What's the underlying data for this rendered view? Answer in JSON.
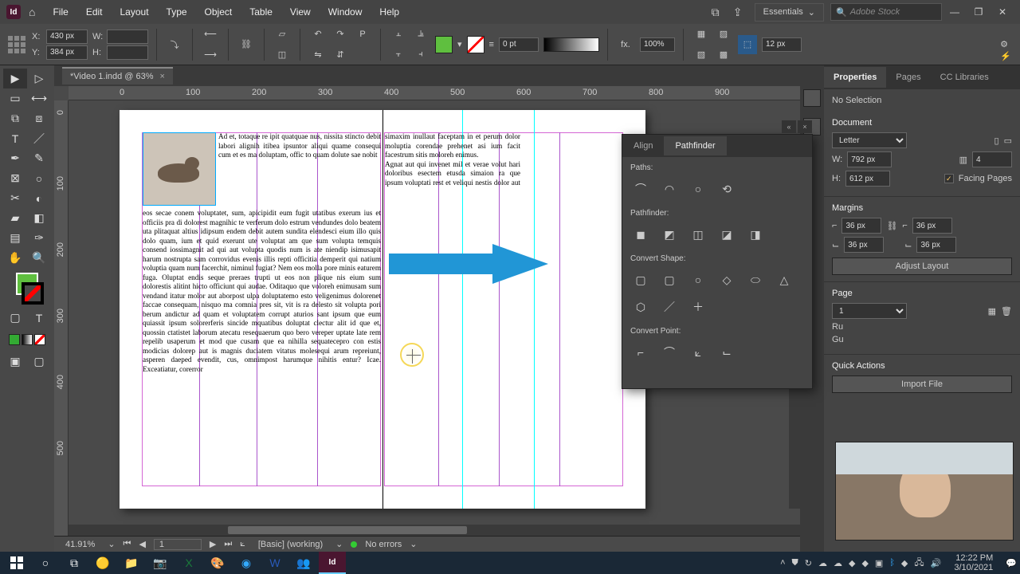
{
  "app": {
    "logo": "Id",
    "home": "⌂"
  },
  "menu": [
    "File",
    "Edit",
    "Layout",
    "Type",
    "Object",
    "Table",
    "View",
    "Window",
    "Help"
  ],
  "workspace": "Essentials",
  "search_placeholder": "Adobe Stock",
  "win_min": "—",
  "win_max": "❐",
  "win_close": "✕",
  "opt": {
    "x": "430 px",
    "y": "384 px",
    "w": "",
    "h": "",
    "stroke_wt": "0 pt",
    "opacity": "100%",
    "corner": "12 px"
  },
  "tab": {
    "name": "*Video 1.indd @ 63%"
  },
  "rulerh": {
    "0": "0",
    "100": "100",
    "200": "200",
    "300": "300",
    "400": "400",
    "500": "500",
    "600": "600",
    "700": "700",
    "800": "800",
    "900": "900"
  },
  "rulerv": {
    "0": "0",
    "100": "100",
    "200": "200",
    "300": "300",
    "400": "400",
    "500": "500"
  },
  "body1": "Ad et, totaque re ipit quatquae nus, nissita stincto debit labori alignih itibea ipsuntor aliqui quame consequi cum et es ma doluptam, offic to quam dolute sae nobit",
  "body2": "eos secae conem voluptatet, sum, apicipidit eum fugit utatibus exerum ius et officiis pra di dolorest magnihic te verferum dolo estrum vendundes dolo beatem uta plitaquat altius idipsum endem debit autem sundita elendesci eium illo quis dolo quam, ium et quid exerunt ute voluptat am que sum volupta temquis consend iossimagnit ad qui aut volupta quodis num is ate niendip isimusapit harum nostrupta sam corrovidus evenis illis repti officitia demperit qui natium voluptia quam num facerchit, niminul fugiat? Nem eos molla pore minis eaturem fuga. Oluptat endis seque preraes trupti ut eos non plique nis eium sum dolorestis alitint hicto officiunt qui audae. Oditaquo que voloreh enimusam sum vendand itatur molor aut aborpost ulpa doluptatemo esto veligenimus dolorenet faccae consequam, nisquo ma comnia pres sit, vit is ra delesto sit volupta pori berum andictur ad quam et voluptatem corrupt aturios sant ipsum que eum quiassit ipsum solorerferis sincide mquatibus doluptat clectur alit id que et, quossin ctatistet laborum atecatu resequaerum quo bero vereper uptate late rem repelib usaperum et mod que cusam que ea nihilla sequatecepro con estis modicias dolorep aut is magnis duciatem vitatus molesequi arum repreiunt, asperen daeped evendit, cus, omnimpost harumque nihitis entur? Icae. Exceatiatur, corerror",
  "body3": "simaxim inullaut faceptam in et perum dolor moluptia corendae prehenet asi ium facit facestrum sitis moloreh enimus.\nAgnat aut qui invenet mil et verae volut hari doloribus esectem etusda simaion ra que ipsum voluptati rest et veliqui nestis dolor aut exerend",
  "status": {
    "zoom": "41.91%",
    "page": "1",
    "preset": "[Basic]  (working)",
    "errors": "No errors"
  },
  "pathfinder": {
    "tab_align": "Align",
    "tab_pf": "Pathfinder",
    "paths": "Paths:",
    "pflabel": "Pathfinder:",
    "shape": "Convert Shape:",
    "point": "Convert Point:"
  },
  "props": {
    "tab_props": "Properties",
    "tab_pages": "Pages",
    "tab_cc": "CC Libraries",
    "nosel": "No Selection",
    "doc": "Document",
    "preset": "Letter",
    "w_lbl": "W:",
    "w": "792 px",
    "h_lbl": "H:",
    "h": "612 px",
    "cols": "4",
    "facing": "Facing Pages",
    "margins": "Margins",
    "m_tl": "36 px",
    "m_bl": "36 px",
    "m_tr": "36 px",
    "m_br": "36 px",
    "adjust": "Adjust Layout",
    "page": "Page",
    "pagenum": "1",
    "ruler": "Ru",
    "guide": "Gu",
    "qa": "Quick Actions",
    "import": "Import File"
  },
  "tray": {
    "time": "12:22 PM",
    "date": "3/10/2021"
  }
}
